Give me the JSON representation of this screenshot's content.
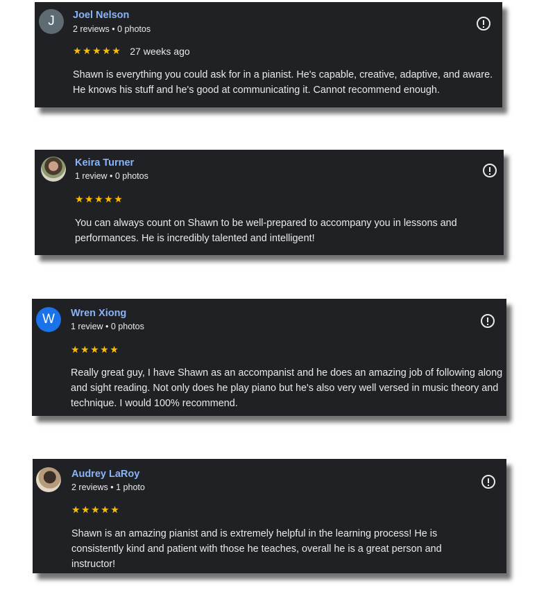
{
  "reviews": [
    {
      "avatar_letter": "J",
      "avatar_color": "#5f6b73",
      "name": "Joel Nelson",
      "meta": "2 reviews • 0 photos",
      "stars": "★★★★★",
      "rating": 5,
      "date": "27 weeks ago",
      "text": "Shawn is everything you could ask for in a pianist. He's capable, creative, adaptive, and aware. He knows his stuff and he's good at communicating it. Cannot recommend enough."
    },
    {
      "avatar_letter": "",
      "avatar_color": "",
      "name": "Keira Turner",
      "meta": "1 review • 0 photos",
      "stars": "★★★★★",
      "rating": 5,
      "date": "",
      "text": "You can always count on Shawn to be well-prepared to accompany you in lessons and performances. He is incredibly talented and intelligent!"
    },
    {
      "avatar_letter": "W",
      "avatar_color": "#1a73e8",
      "name": "Wren Xiong",
      "meta": "1 review • 0 photos",
      "stars": "★★★★★",
      "rating": 5,
      "date": "",
      "text": "Really great guy, I have Shawn as an accompanist and he does an amazing job of following along and sight reading. Not only does he play piano but he's also very well versed in music theory and technique. I would 100% recommend."
    },
    {
      "avatar_letter": "",
      "avatar_color": "",
      "name": "Audrey LaRoy",
      "meta": "2 reviews • 1 photo",
      "stars": "★★★★★",
      "rating": 5,
      "date": "",
      "text": "Shawn is an amazing pianist and is extremely helpful in the learning process! He is consistently kind and patient with those he teaches, overall he is a great person and instructor!"
    }
  ],
  "colors": {
    "card_background": "#202124",
    "name_link": "#8ab4f8",
    "star": "#fbbc04",
    "text": "#e8eaed"
  }
}
